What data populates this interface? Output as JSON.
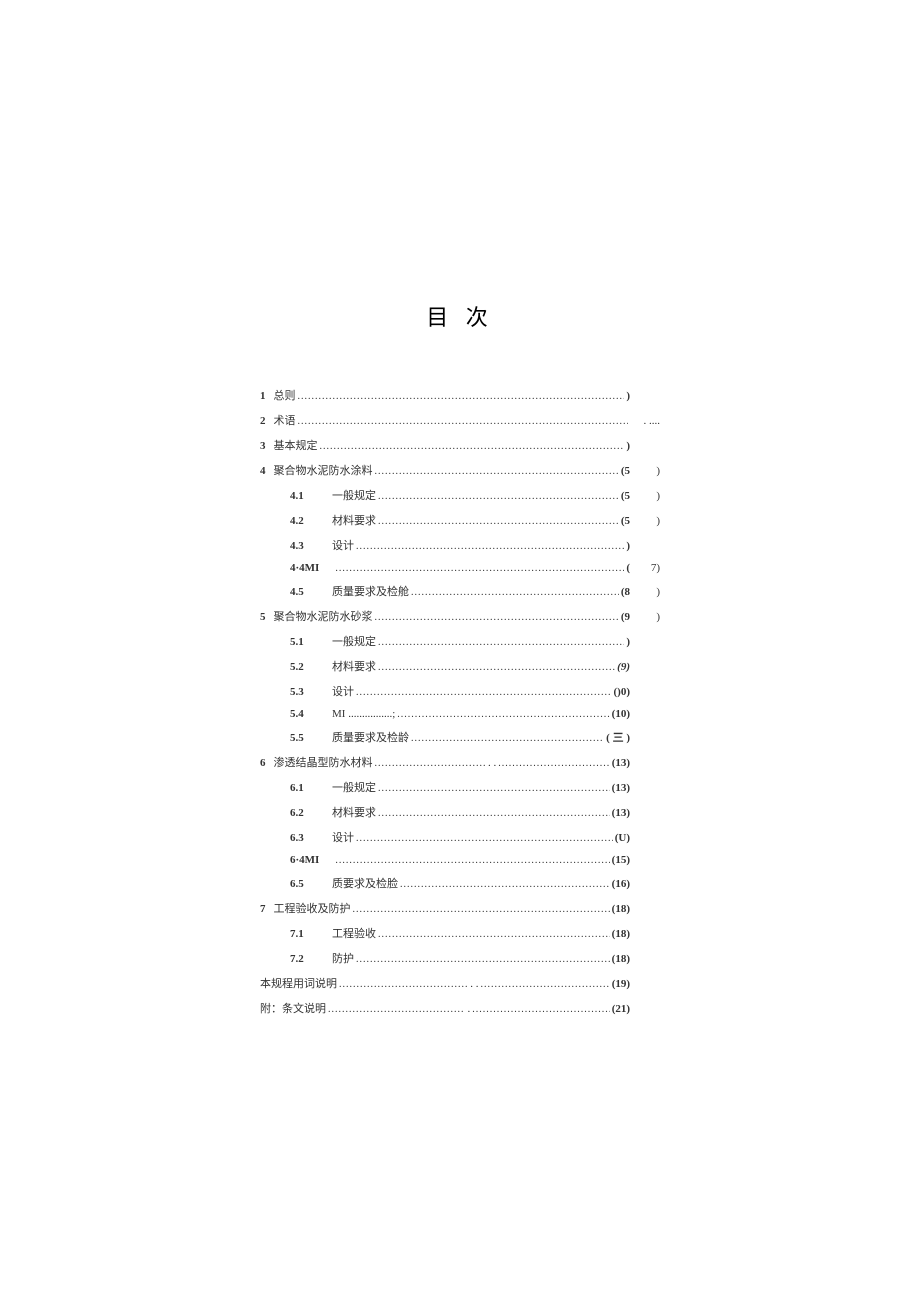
{
  "title": "目 次",
  "toc": [
    {
      "type": "main",
      "num": "1",
      "label": "总则",
      "page": ")",
      "trail": ""
    },
    {
      "type": "main",
      "num": "2",
      "label": "术语",
      "page": "",
      "trail": ". ...."
    },
    {
      "type": "main",
      "num": "3",
      "label": "基本规定",
      "page": ")",
      "trail": ""
    },
    {
      "type": "main",
      "num": "4",
      "label": "聚合物水泥防水涂料",
      "page": "(5",
      "trail": ")"
    },
    {
      "type": "sub",
      "num": "4.1",
      "label": "一般规定",
      "page": "(5",
      "trail": ")"
    },
    {
      "type": "sub",
      "num": "4.2",
      "label": "材料要求",
      "page": "(5",
      "trail": ")"
    },
    {
      "type": "sub",
      "num": "4.3",
      "label": "设计",
      "page": ")",
      "trail": ""
    },
    {
      "type": "sub",
      "num": "4·4MI",
      "label": "",
      "page": "(",
      "trail": "7)"
    },
    {
      "type": "sub",
      "num": "4.5",
      "label": "质量要求及检舱",
      "page": "(8",
      "trail": ")"
    },
    {
      "type": "main",
      "num": "5",
      "label": "聚合物水泥防水砂浆",
      "page": "(9",
      "trail": ")"
    },
    {
      "type": "sub",
      "num": "5.1",
      "label": "一般规定",
      "page": ")",
      "trail": ""
    },
    {
      "type": "sub",
      "num": "5.2",
      "label": "材料要求",
      "page": "(9)",
      "trail": "",
      "italic": true
    },
    {
      "type": "sub",
      "num": "5.3",
      "label": "设计",
      "page": "()0)",
      "trail": ""
    },
    {
      "type": "sub",
      "num": "5.4",
      "label": "MI ................;",
      "page": "(10)",
      "trail": ""
    },
    {
      "type": "sub",
      "num": "5.5",
      "label": "质量要求及检龄",
      "page": "( 三 )",
      "trail": ""
    },
    {
      "type": "main",
      "num": "6",
      "label": "渗透结晶型防水材料",
      "mid": ". .",
      "page": "(13)",
      "trail": ""
    },
    {
      "type": "sub",
      "num": "6.1",
      "label": "一般规定",
      "page": "(13)",
      "trail": ""
    },
    {
      "type": "sub",
      "num": "6.2",
      "label": "材料要求",
      "page": "(13)",
      "trail": ""
    },
    {
      "type": "sub",
      "num": "6.3",
      "label": "设计",
      "page": "(U)",
      "trail": ""
    },
    {
      "type": "sub",
      "num": "6·4MI",
      "label": "",
      "page": "(15)",
      "trail": ""
    },
    {
      "type": "sub",
      "num": "6.5",
      "label": "质要求及检脸",
      "page": "(16)",
      "trail": ""
    },
    {
      "type": "main",
      "num": "7",
      "label": "工程验收及防护",
      "page": "(18)",
      "trail": ""
    },
    {
      "type": "sub",
      "num": "7.1",
      "label": "工程验收",
      "page": "(18)",
      "trail": ""
    },
    {
      "type": "sub",
      "num": "7.2",
      "label": "防护",
      "page": "(18)",
      "trail": ""
    },
    {
      "type": "plain",
      "label": "本规程用词说明",
      "mid": ". .",
      "page": "(19)",
      "trail": ""
    },
    {
      "type": "plain",
      "label": "附：条文说明",
      "mid": ".",
      "page": "(21)",
      "trail": ""
    }
  ]
}
